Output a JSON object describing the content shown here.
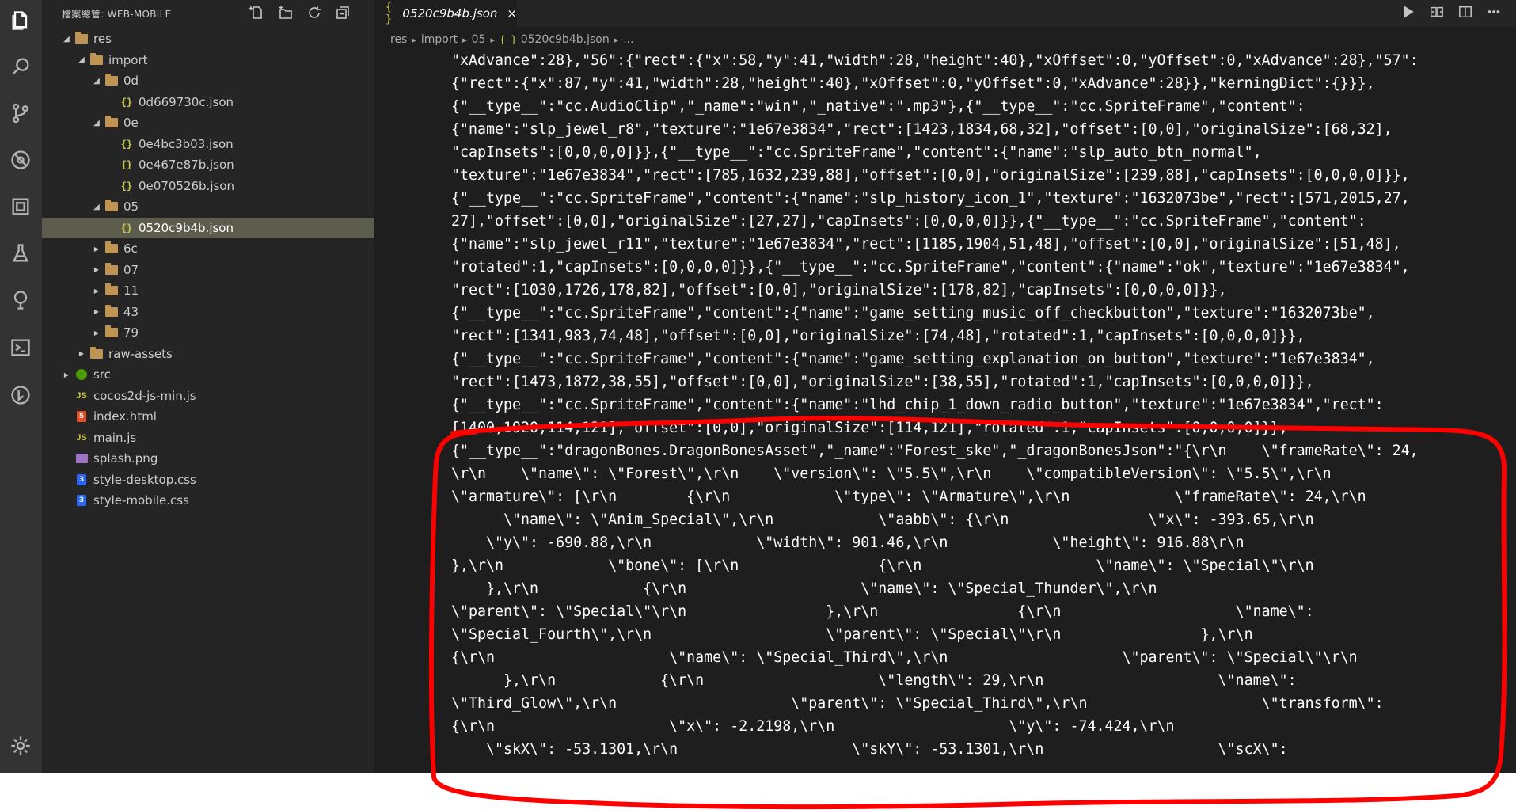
{
  "explorer": {
    "title": "檔案總管: WEB-MOBILE",
    "actions": [
      "new-file-icon",
      "new-folder-icon",
      "refresh-icon",
      "collapse-icon"
    ]
  },
  "tree": [
    {
      "label": "res",
      "type": "folder",
      "depth": 0,
      "expanded": true
    },
    {
      "label": "import",
      "type": "folder",
      "depth": 1,
      "expanded": true
    },
    {
      "label": "0d",
      "type": "folder",
      "depth": 2,
      "expanded": true
    },
    {
      "label": "0d669730c.json",
      "type": "json",
      "depth": 3
    },
    {
      "label": "0e",
      "type": "folder",
      "depth": 2,
      "expanded": true
    },
    {
      "label": "0e4bc3b03.json",
      "type": "json",
      "depth": 3
    },
    {
      "label": "0e467e87b.json",
      "type": "json",
      "depth": 3
    },
    {
      "label": "0e070526b.json",
      "type": "json",
      "depth": 3
    },
    {
      "label": "05",
      "type": "folder",
      "depth": 2,
      "expanded": true
    },
    {
      "label": "0520c9b4b.json",
      "type": "json",
      "depth": 3,
      "selected": true
    },
    {
      "label": "6c",
      "type": "folder",
      "depth": 2,
      "expanded": false
    },
    {
      "label": "07",
      "type": "folder",
      "depth": 2,
      "expanded": false
    },
    {
      "label": "11",
      "type": "folder",
      "depth": 2,
      "expanded": false
    },
    {
      "label": "43",
      "type": "folder",
      "depth": 2,
      "expanded": false
    },
    {
      "label": "79",
      "type": "folder",
      "depth": 2,
      "expanded": false
    },
    {
      "label": "raw-assets",
      "type": "folder",
      "depth": 1,
      "expanded": false
    },
    {
      "label": "src",
      "type": "src",
      "depth": 0,
      "expanded": false
    },
    {
      "label": "cocos2d-js-min.js",
      "type": "js",
      "depth": 0
    },
    {
      "label": "index.html",
      "type": "html",
      "depth": 0
    },
    {
      "label": "main.js",
      "type": "js",
      "depth": 0
    },
    {
      "label": "splash.png",
      "type": "png",
      "depth": 0
    },
    {
      "label": "style-desktop.css",
      "type": "css",
      "depth": 0
    },
    {
      "label": "style-mobile.css",
      "type": "css",
      "depth": 0
    }
  ],
  "tab": {
    "icon": "{ }",
    "label": "0520c9b4b.json",
    "close": "×"
  },
  "breadcrumb": {
    "parts": [
      "res",
      "import",
      "05"
    ],
    "file_icon": "{ }",
    "file": "0520c9b4b.json",
    "more": "..."
  },
  "code_lines": [
    "\"xAdvance\":28},\"56\":{\"rect\":{\"x\":58,\"y\":41,\"width\":28,\"height\":40},\"xOffset\":0,\"yOffset\":0,\"xAdvance\":28},\"57\":",
    "{\"rect\":{\"x\":87,\"y\":41,\"width\":28,\"height\":40},\"xOffset\":0,\"yOffset\":0,\"xAdvance\":28}},\"kerningDict\":{}}},",
    "{\"__type__\":\"cc.AudioClip\",\"_name\":\"win\",\"_native\":\".mp3\"},{\"__type__\":\"cc.SpriteFrame\",\"content\":",
    "{\"name\":\"slp_jewel_r8\",\"texture\":\"1e67e3834\",\"rect\":[1423,1834,68,32],\"offset\":[0,0],\"originalSize\":[68,32],",
    "\"capInsets\":[0,0,0,0]}},{\"__type__\":\"cc.SpriteFrame\",\"content\":{\"name\":\"slp_auto_btn_normal\",",
    "\"texture\":\"1e67e3834\",\"rect\":[785,1632,239,88],\"offset\":[0,0],\"originalSize\":[239,88],\"capInsets\":[0,0,0,0]}},",
    "{\"__type__\":\"cc.SpriteFrame\",\"content\":{\"name\":\"slp_history_icon_1\",\"texture\":\"1632073be\",\"rect\":[571,2015,27,",
    "27],\"offset\":[0,0],\"originalSize\":[27,27],\"capInsets\":[0,0,0,0]}},{\"__type__\":\"cc.SpriteFrame\",\"content\":",
    "{\"name\":\"slp_jewel_r11\",\"texture\":\"1e67e3834\",\"rect\":[1185,1904,51,48],\"offset\":[0,0],\"originalSize\":[51,48],",
    "\"rotated\":1,\"capInsets\":[0,0,0,0]}},{\"__type__\":\"cc.SpriteFrame\",\"content\":{\"name\":\"ok\",\"texture\":\"1e67e3834\",",
    "\"rect\":[1030,1726,178,82],\"offset\":[0,0],\"originalSize\":[178,82],\"capInsets\":[0,0,0,0]}},",
    "{\"__type__\":\"cc.SpriteFrame\",\"content\":{\"name\":\"game_setting_music_off_checkbutton\",\"texture\":\"1632073be\",",
    "\"rect\":[1341,983,74,48],\"offset\":[0,0],\"originalSize\":[74,48],\"rotated\":1,\"capInsets\":[0,0,0,0]}},",
    "{\"__type__\":\"cc.SpriteFrame\",\"content\":{\"name\":\"game_setting_explanation_on_button\",\"texture\":\"1e67e3834\",",
    "\"rect\":[1473,1872,38,55],\"offset\":[0,0],\"originalSize\":[38,55],\"rotated\":1,\"capInsets\":[0,0,0,0]}},",
    "{\"__type__\":\"cc.SpriteFrame\",\"content\":{\"name\":\"lhd_chip_1_down_radio_button\",\"texture\":\"1e67e3834\",\"rect\":",
    "[1400,1920,114,121],\"offset\":[0,0],\"originalSize\":[114,121],\"rotated\":1,\"capInsets\":[0,0,0,0]}},",
    "{\"__type__\":\"dragonBones.DragonBonesAsset\",\"_name\":\"Forest_ske\",\"_dragonBonesJson\":\"{\\r\\n    \\\"frameRate\\\": 24,",
    "\\r\\n    \\\"name\\\": \\\"Forest\\\",\\r\\n    \\\"version\\\": \\\"5.5\\\",\\r\\n    \\\"compatibleVersion\\\": \\\"5.5\\\",\\r\\n",
    "\\\"armature\\\": [\\r\\n        {\\r\\n            \\\"type\\\": \\\"Armature\\\",\\r\\n            \\\"frameRate\\\": 24,\\r\\n",
    "      \\\"name\\\": \\\"Anim_Special\\\",\\r\\n            \\\"aabb\\\": {\\r\\n                \\\"x\\\": -393.65,\\r\\n",
    "    \\\"y\\\": -690.88,\\r\\n            \\\"width\\\": 901.46,\\r\\n            \\\"height\\\": 916.88\\r\\n",
    "},\\r\\n            \\\"bone\\\": [\\r\\n                {\\r\\n                    \\\"name\\\": \\\"Special\\\"\\r\\n",
    "    },\\r\\n            {\\r\\n                    \\\"name\\\": \\\"Special_Thunder\\\",\\r\\n",
    "\\\"parent\\\": \\\"Special\\\"\\r\\n                },\\r\\n                {\\r\\n                    \\\"name\\\":",
    "\\\"Special_Fourth\\\",\\r\\n                    \\\"parent\\\": \\\"Special\\\"\\r\\n                },\\r\\n",
    "{\\r\\n                    \\\"name\\\": \\\"Special_Third\\\",\\r\\n                    \\\"parent\\\": \\\"Special\\\"\\r\\n",
    "      },\\r\\n            {\\r\\n                    \\\"length\\\": 29,\\r\\n                    \\\"name\\\":",
    "\\\"Third_Glow\\\",\\r\\n                    \\\"parent\\\": \\\"Special_Third\\\",\\r\\n                    \\\"transform\\\":",
    "{\\r\\n                    \\\"x\\\": -2.2198,\\r\\n                    \\\"y\\\": -74.424,\\r\\n",
    "    \\\"skX\\\": -53.1301,\\r\\n                    \\\"skY\\\": -53.1301,\\r\\n                    \\\"scX\\\":"
  ],
  "colors": {
    "activity_bar": "#333333",
    "sidebar": "#252526",
    "editor": "#1e1e1e",
    "selection": "#5c5c4d",
    "annotation": "#ff0000",
    "folder": "#c09553",
    "json_icon": "#cbcb41"
  }
}
